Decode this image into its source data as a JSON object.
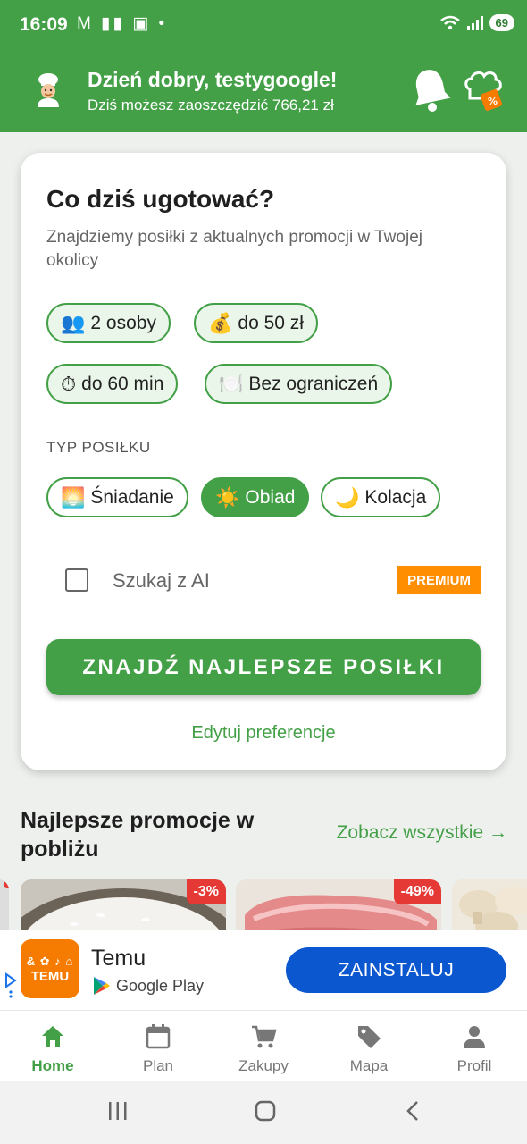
{
  "status_bar": {
    "time": "16:09",
    "notif_icons": "M ▮▮ ▣ •",
    "battery": "69"
  },
  "header": {
    "greeting": "Dzień dobry, testygoogle!",
    "savings": "Dziś możesz zaoszczędzić 766,21 zł",
    "colors": {
      "brand_green": "#43a047"
    }
  },
  "card": {
    "title": "Co dziś ugotować?",
    "subtitle": "Znajdziemy posiłki z aktualnych promocji w Twojej okolicy",
    "filters": [
      {
        "emoji": "👥",
        "label": "2 osoby"
      },
      {
        "emoji": "💰",
        "label": "do 50 zł"
      },
      {
        "emoji": "⏱",
        "label": "do 60 min"
      },
      {
        "emoji": "🍽️",
        "label": "Bez ograniczeń"
      }
    ],
    "meal_type_label": "TYP POSIŁKU",
    "meal_types": [
      {
        "emoji": "🌅",
        "label": "Śniadanie",
        "selected": false
      },
      {
        "emoji": "☀️",
        "label": "Obiad",
        "selected": true
      },
      {
        "emoji": "🌙",
        "label": "Kolacja",
        "selected": false
      }
    ],
    "ai_search": {
      "label": "Szukaj z AI",
      "checked": false,
      "badge": "PREMIUM"
    },
    "find_button": "ZNAJDŹ NAJLEPSZE POSIŁKI",
    "edit_link": "Edytuj preferencje"
  },
  "promotions": {
    "title": "Najlepsze promocje w pobliżu",
    "see_all": "Zobacz wszystkie →",
    "items": [
      {
        "discount": "-3%"
      },
      {
        "discount": "-49%"
      }
    ]
  },
  "ad": {
    "logo_line1": "&  ✿ ♪ ⌂",
    "logo_line2": "TEMU",
    "app_name": "Temu",
    "store": "Google Play",
    "install": "ZAINSTALUJ"
  },
  "bottom_nav": {
    "items": [
      {
        "label": "Home",
        "icon": "home-icon",
        "active": true
      },
      {
        "label": "Plan",
        "icon": "calendar-icon",
        "active": false
      },
      {
        "label": "Zakupy",
        "icon": "cart-icon",
        "active": false
      },
      {
        "label": "Mapa",
        "icon": "tag-icon",
        "active": false
      },
      {
        "label": "Profil",
        "icon": "person-icon",
        "active": false
      }
    ]
  }
}
